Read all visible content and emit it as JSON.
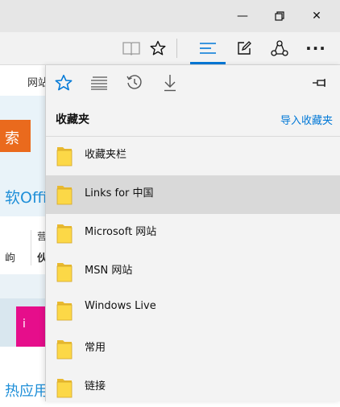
{
  "window_controls": {
    "minimize_glyph": "—",
    "restore_glyph": "❐",
    "close_glyph": "✕"
  },
  "toolbar": {
    "reading_view_icon": "book-icon",
    "favorite_icon": "star-outline-icon",
    "hub_icon": "hub-lines-icon",
    "note_icon": "pen-square-icon",
    "share_icon": "share-icon",
    "more_glyph": "···",
    "accent_color": "#0078d7"
  },
  "background_page": {
    "nav_text": "网站",
    "button_text": "索",
    "headline": "软Offi",
    "cell_text_1": "岣",
    "cell_text_2a": "营",
    "cell_text_2b": "伙",
    "promo_text": "i",
    "footer_heading": "热应用",
    "accent_orange": "#ea6a1d",
    "accent_pink": "#e60e8b",
    "link_blue": "#1f8fd8"
  },
  "hub": {
    "tabs": [
      {
        "name": "favorites",
        "icon": "star-outline-icon",
        "active": true
      },
      {
        "name": "reading-list",
        "icon": "reading-list-icon",
        "active": false
      },
      {
        "name": "history",
        "icon": "history-icon",
        "active": false
      },
      {
        "name": "downloads",
        "icon": "download-icon",
        "active": false
      }
    ],
    "pin_icon": "pin-icon",
    "title": "收藏夹",
    "import_link": "导入收藏夹",
    "items": [
      {
        "label": "收藏夹栏",
        "selected": false
      },
      {
        "label": "Links for 中国",
        "selected": true
      },
      {
        "label": "Microsoft 网站",
        "selected": false
      },
      {
        "label": "MSN 网站",
        "selected": false
      },
      {
        "label": "Windows Live",
        "selected": false
      },
      {
        "label": "常用",
        "selected": false
      },
      {
        "label": "链接",
        "selected": false
      }
    ],
    "folder_color": "#fcd847",
    "selected_bg": "#d9d9d9"
  }
}
